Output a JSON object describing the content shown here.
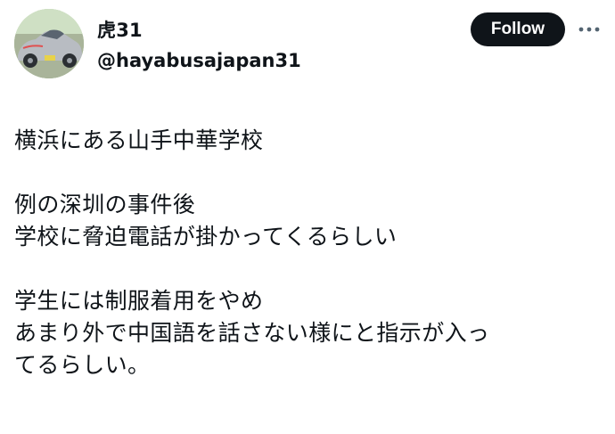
{
  "author": {
    "display_name": "虎31",
    "handle": "@hayabusajapan31",
    "avatar_icon": "car-photo-avatar"
  },
  "actions": {
    "follow_label": "Follow",
    "more_icon": "more-dots-icon"
  },
  "tweet": {
    "paragraphs": [
      {
        "lines": [
          "横浜にある山手中華学校"
        ]
      },
      {
        "lines": [
          "例の深圳の事件後",
          "学校に脅迫電話が掛かってくるらしい"
        ]
      },
      {
        "lines": [
          "学生には制服着用をやめ",
          "あまり外で中国語を話さない様にと指示が入っ",
          "てるらしい。"
        ]
      }
    ]
  },
  "colors": {
    "text": "#0f1419",
    "follow_bg": "#0f1419",
    "follow_text": "#ffffff",
    "background": "#ffffff"
  }
}
